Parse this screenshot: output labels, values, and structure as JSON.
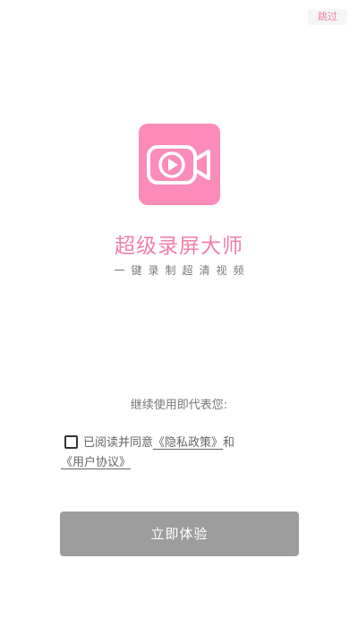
{
  "header": {
    "skip_label": "跳过"
  },
  "brand": {
    "logo_icon": "video-camera-play-icon",
    "app_name": "超级录屏大师",
    "slogan": "一键录制超清视频"
  },
  "consent": {
    "lead_text": "继续使用即代表您:",
    "checkbox_checked": false,
    "prefix_text": "已阅读并同意",
    "privacy_link": "《隐私政策》",
    "and_text": "和",
    "user_agreement_link": "《用户协议》"
  },
  "actions": {
    "start_label": "立即体验"
  },
  "colors": {
    "brand_pink": "#fb8bb8",
    "title_pink": "#f07fa8",
    "button_disabled": "#9d9d9d"
  }
}
